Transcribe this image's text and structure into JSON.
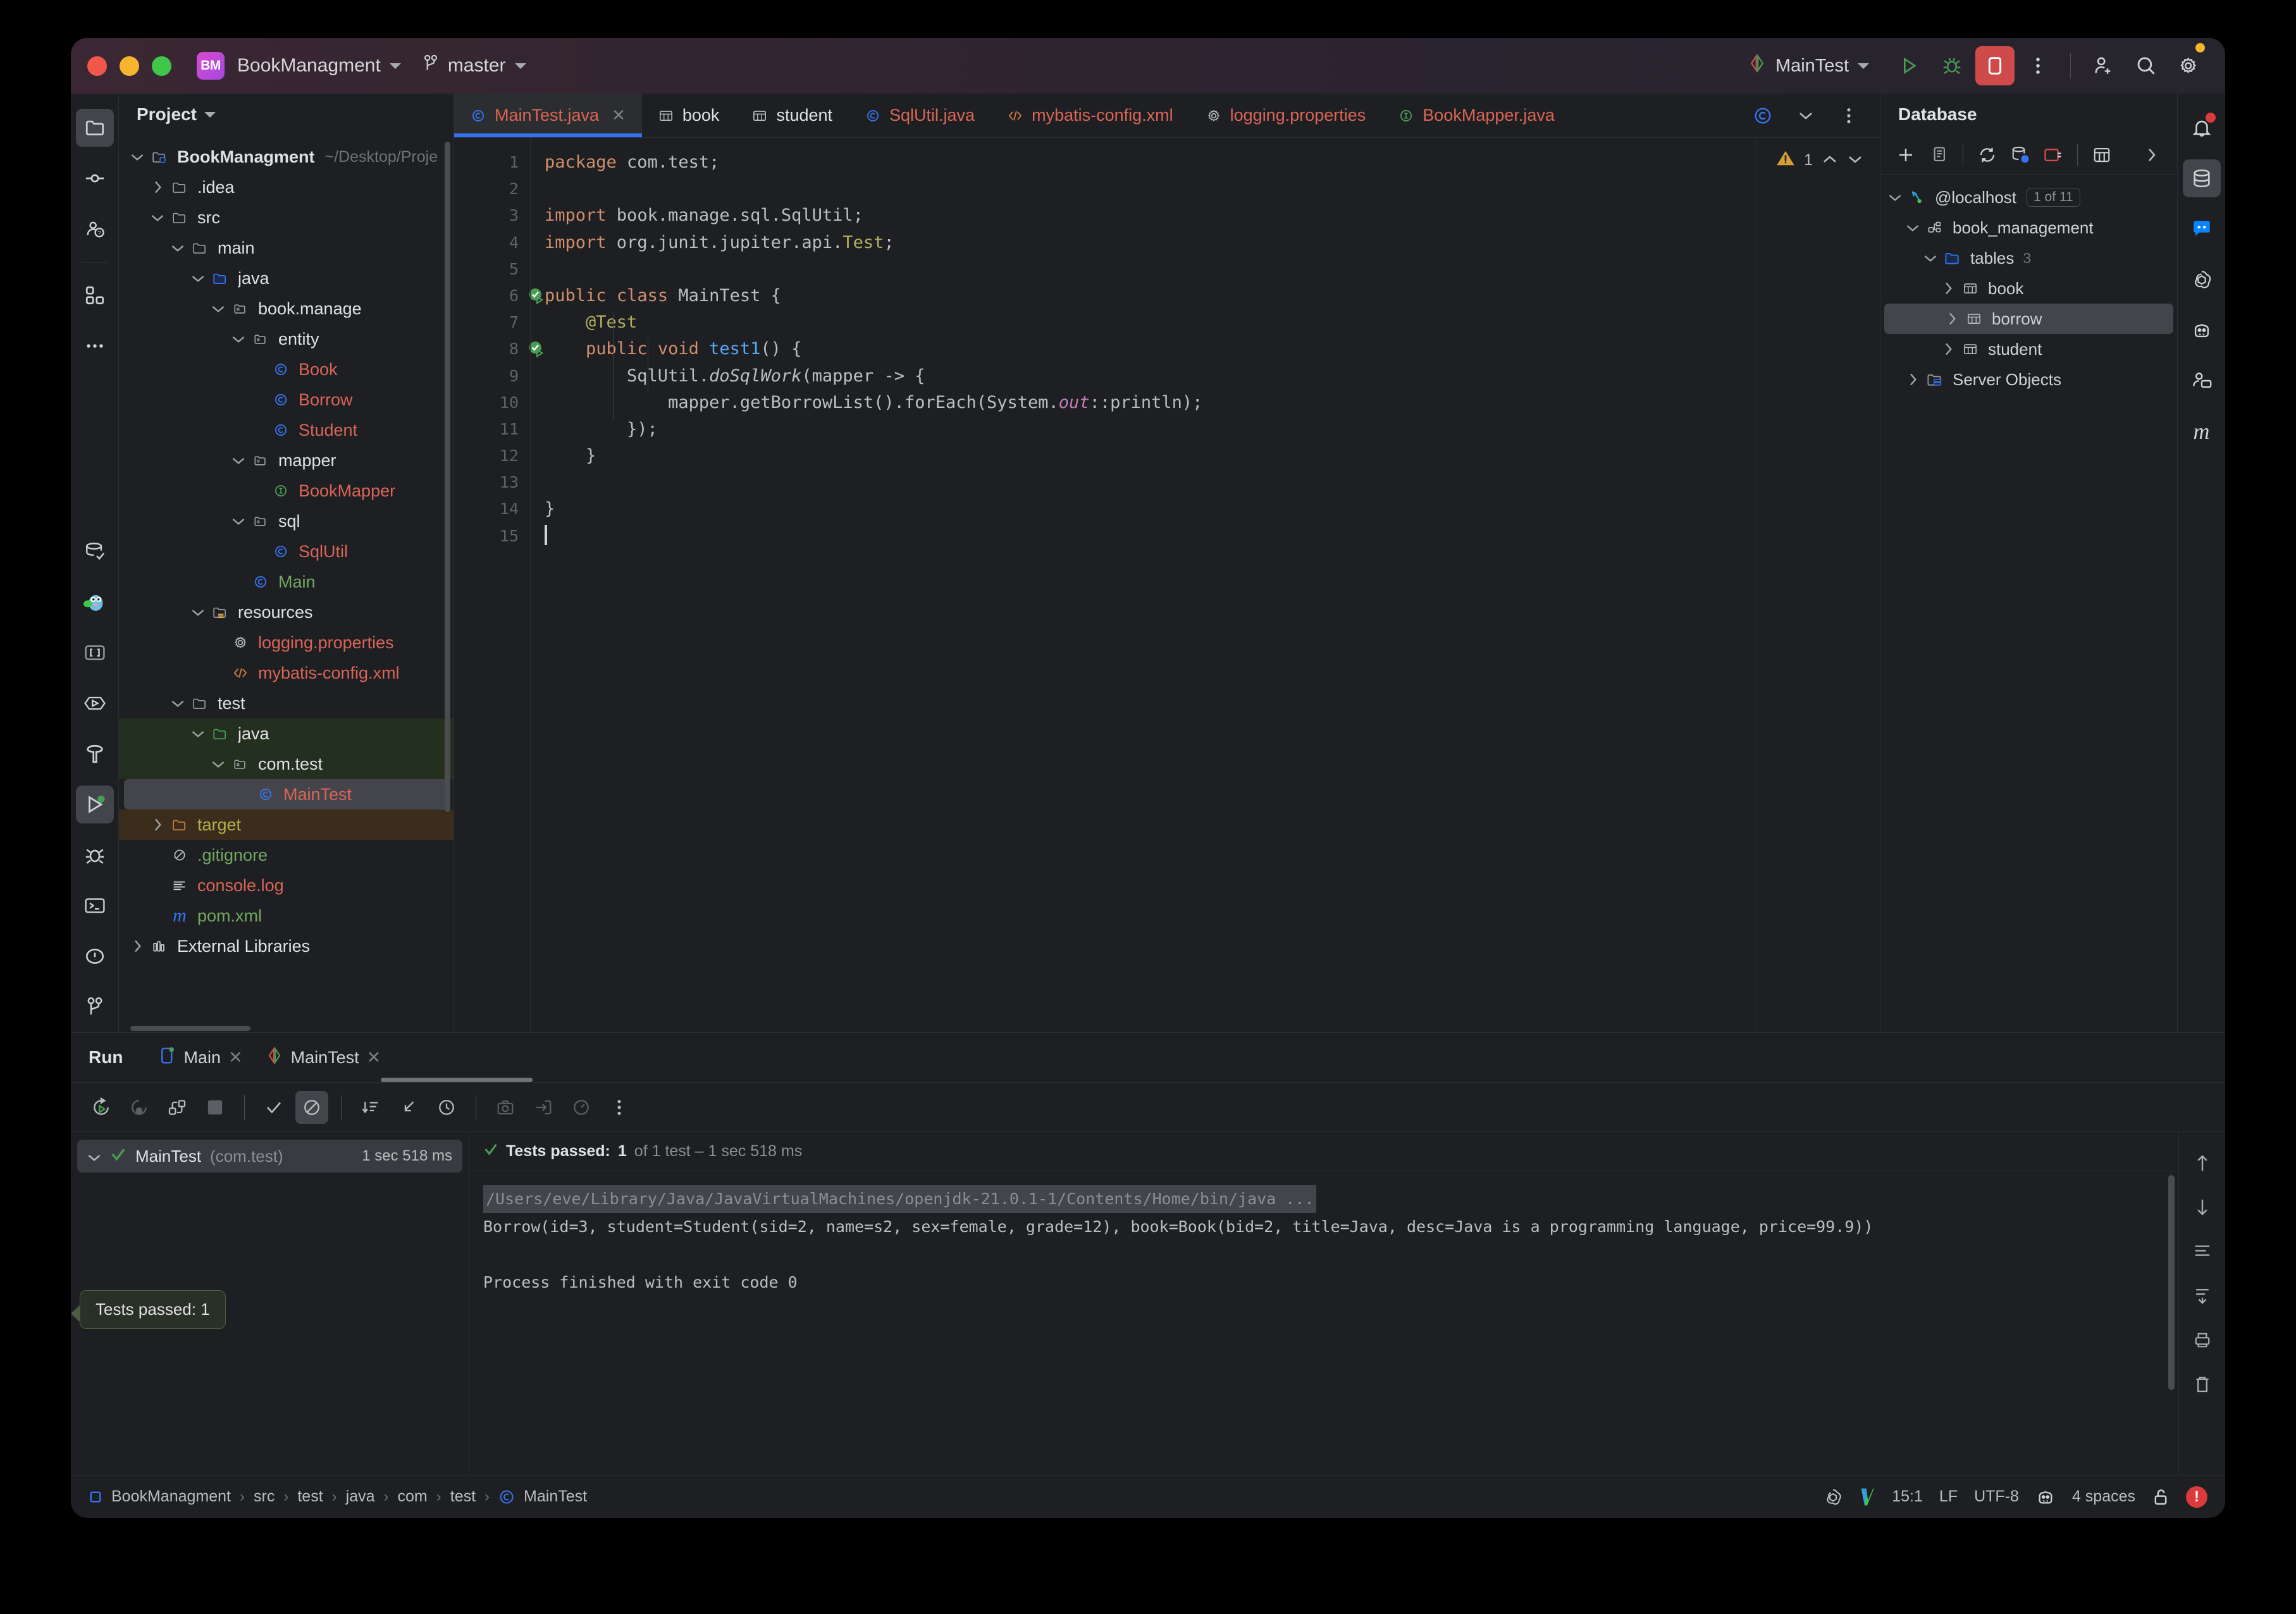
{
  "titlebar": {
    "project_badge": "BM",
    "project_name": "BookManagment",
    "branch": "master",
    "run_config": "MainTest"
  },
  "project_panel": {
    "header": "Project",
    "tree": [
      {
        "label": "BookManagment",
        "path": "~/Desktop/Proje",
        "icon": "module-folder-icon",
        "depth": 0,
        "twist": "down",
        "color": "white",
        "bold": true
      },
      {
        "label": ".idea",
        "icon": "folder-icon",
        "depth": 1,
        "twist": "right",
        "color": "white"
      },
      {
        "label": "src",
        "icon": "folder-icon",
        "depth": 1,
        "twist": "down",
        "color": "white"
      },
      {
        "label": "main",
        "icon": "folder-icon",
        "depth": 2,
        "twist": "down",
        "color": "white"
      },
      {
        "label": "java",
        "icon": "source-folder-icon",
        "depth": 3,
        "twist": "down",
        "color": "white"
      },
      {
        "label": "book.manage",
        "icon": "package-icon",
        "depth": 4,
        "twist": "down",
        "color": "white"
      },
      {
        "label": "entity",
        "icon": "package-icon",
        "depth": 5,
        "twist": "down",
        "color": "white"
      },
      {
        "label": "Book",
        "icon": "java-class-icon",
        "depth": 6,
        "twist": "none",
        "color": "red"
      },
      {
        "label": "Borrow",
        "icon": "java-class-icon",
        "depth": 6,
        "twist": "none",
        "color": "red"
      },
      {
        "label": "Student",
        "icon": "java-class-icon",
        "depth": 6,
        "twist": "none",
        "color": "red"
      },
      {
        "label": "mapper",
        "icon": "package-icon",
        "depth": 5,
        "twist": "down",
        "color": "white"
      },
      {
        "label": "BookMapper",
        "icon": "java-interface-icon",
        "depth": 6,
        "twist": "none",
        "color": "red"
      },
      {
        "label": "sql",
        "icon": "package-icon",
        "depth": 5,
        "twist": "down",
        "color": "white"
      },
      {
        "label": "SqlUtil",
        "icon": "java-class-icon",
        "depth": 6,
        "twist": "none",
        "color": "red"
      },
      {
        "label": "Main",
        "icon": "java-class-icon",
        "depth": 5,
        "twist": "none",
        "color": "green"
      },
      {
        "label": "resources",
        "icon": "resources-folder-icon",
        "depth": 3,
        "twist": "down",
        "color": "white"
      },
      {
        "label": "logging.properties",
        "icon": "gear-icon",
        "depth": 4,
        "twist": "none",
        "color": "red"
      },
      {
        "label": "mybatis-config.xml",
        "icon": "xml-icon",
        "depth": 4,
        "twist": "none",
        "color": "red"
      },
      {
        "label": "test",
        "icon": "folder-icon",
        "depth": 2,
        "twist": "down",
        "color": "white"
      },
      {
        "label": "java",
        "icon": "test-source-folder-icon",
        "depth": 3,
        "twist": "down",
        "color": "white",
        "bg": "green"
      },
      {
        "label": "com.test",
        "icon": "package-icon",
        "depth": 4,
        "twist": "down",
        "color": "white",
        "bg": "green"
      },
      {
        "label": "MainTest",
        "icon": "java-class-icon",
        "depth": 5,
        "twist": "none",
        "color": "red",
        "selected": true
      },
      {
        "label": "target",
        "icon": "excluded-folder-icon",
        "depth": 1,
        "twist": "right",
        "color": "yellow",
        "bg": "target"
      },
      {
        "label": ".gitignore",
        "icon": "gitignore-icon",
        "depth": 1,
        "twist": "none",
        "color": "green"
      },
      {
        "label": "console.log",
        "icon": "log-file-icon",
        "depth": 1,
        "twist": "none",
        "color": "red"
      },
      {
        "label": "pom.xml",
        "icon": "maven-icon",
        "depth": 1,
        "twist": "none",
        "color": "green"
      },
      {
        "label": "External Libraries",
        "icon": "libraries-icon",
        "depth": 0,
        "twist": "right",
        "color": "white"
      }
    ]
  },
  "editor": {
    "tabs": [
      {
        "label": "MainTest.java",
        "icon": "java-class-icon",
        "color": "red",
        "active": true,
        "closeable": true
      },
      {
        "label": "book",
        "icon": "table-icon",
        "color": "white",
        "active": false
      },
      {
        "label": "student",
        "icon": "table-icon",
        "color": "white",
        "active": false
      },
      {
        "label": "SqlUtil.java",
        "icon": "java-class-icon",
        "color": "red",
        "active": false
      },
      {
        "label": "mybatis-config.xml",
        "icon": "xml-icon",
        "color": "red",
        "active": false
      },
      {
        "label": "logging.properties",
        "icon": "gear-icon",
        "color": "red",
        "active": false
      },
      {
        "label": "BookMapper.java",
        "icon": "java-interface-icon",
        "color": "red",
        "active": false
      }
    ],
    "warning_count": "1",
    "line_numbers": [
      "1",
      "2",
      "3",
      "4",
      "5",
      "6",
      "7",
      "8",
      "9",
      "10",
      "11",
      "12",
      "13",
      "14",
      "15"
    ],
    "code_lines": [
      "package com.test;",
      "",
      "import book.manage.sql.SqlUtil;",
      "import org.junit.jupiter.api.Test;",
      "",
      "public class MainTest {",
      "    @Test",
      "    public void test1() {",
      "        SqlUtil.doSqlWork(mapper -> {",
      "            mapper.getBorrowList().forEach(System.out::println);",
      "        });",
      "    }",
      "",
      "}",
      ""
    ]
  },
  "database": {
    "header": "Database",
    "toolbar_icons": [
      "add-icon",
      "duplicate-icon",
      "refresh-icon",
      "db-settings-icon",
      "disconnect-icon",
      "table-view-icon",
      "expand-icon"
    ],
    "tree": [
      {
        "label": "@localhost",
        "badge": "1 of 11",
        "icon": "datasource-icon",
        "depth": 0,
        "twist": "down"
      },
      {
        "label": "book_management",
        "icon": "schema-icon",
        "depth": 1,
        "twist": "down"
      },
      {
        "label": "tables",
        "count": "3",
        "icon": "tables-folder-icon",
        "depth": 2,
        "twist": "down"
      },
      {
        "label": "book",
        "icon": "table-icon",
        "depth": 3,
        "twist": "right"
      },
      {
        "label": "borrow",
        "icon": "table-icon",
        "depth": 3,
        "twist": "right",
        "selected": true
      },
      {
        "label": "student",
        "icon": "table-icon",
        "depth": 3,
        "twist": "right"
      },
      {
        "label": "Server Objects",
        "icon": "server-objects-icon",
        "depth": 1,
        "twist": "right"
      }
    ]
  },
  "run_panel": {
    "title": "Run",
    "tabs": [
      {
        "label": "Main",
        "icon": "run-config-app-icon",
        "active": false
      },
      {
        "label": "MainTest",
        "icon": "junit-icon",
        "active": true
      }
    ],
    "toolbar_icons": [
      "rerun-icon",
      "rerun-failed-icon",
      "toggle-auto-test-icon",
      "stop-icon",
      "show-passed-icon",
      "hide-ignored-icon",
      "sort-by-duration-icon",
      "expand-all-icon",
      "history-icon",
      "export-icon",
      "import-icon",
      "settings-gauge-icon",
      "more-icon"
    ],
    "test_tree": {
      "name": "MainTest",
      "package": "(com.test)",
      "duration": "1 sec 518 ms"
    },
    "tooltip": "Tests passed: 1",
    "status": {
      "passed_label": "Tests passed:",
      "passed_count": "1",
      "detail": "of 1 test – 1 sec 518 ms"
    },
    "console": [
      "/Users/eve/Library/Java/JavaVirtualMachines/openjdk-21.0.1-1/Contents/Home/bin/java ...",
      "Borrow(id=3, student=Student(sid=2, name=s2, sex=female, grade=12), book=Book(bid=2, title=Java, desc=Java is a programming language, price=99.9))",
      "",
      "Process finished with exit code 0"
    ],
    "console_rail_icons": [
      "scroll-up-icon",
      "scroll-down-icon",
      "soft-wrap-icon",
      "scroll-end-icon",
      "print-icon",
      "trash-icon"
    ]
  },
  "statusbar": {
    "breadcrumb": [
      "BookManagment",
      "src",
      "test",
      "java",
      "com",
      "test",
      "MainTest"
    ],
    "caret_position": "15:1",
    "line_separator": "LF",
    "encoding": "UTF-8",
    "indent": "4 spaces",
    "right_icons": [
      "openai-icon",
      "vim-icon",
      "ai-assistant-icon",
      "lock-icon",
      "error-icon"
    ]
  },
  "left_rail_icons": [
    "project-icon",
    "commit-icon",
    "pull-requests-icon",
    "plugins-icon",
    "more-icon",
    "database-check-icon",
    "gopher-icon",
    "brackets-icon",
    "preview-icon",
    "build-icon",
    "run-icon",
    "debug-icon",
    "terminal-icon",
    "problems-icon",
    "version-control-icon"
  ],
  "right_rail_icons": [
    "notifications-icon",
    "database-icon",
    "chat-icon",
    "openai-icon",
    "ai-assistant-icon",
    "collaborate-icon",
    "maven-icon"
  ],
  "colors": {
    "accent": "#3574f0",
    "red_file": "#d96557",
    "green_file": "#71a860",
    "stop_red": "#cf4b4b",
    "warning_yellow": "#d4a139",
    "selection": "#43454a"
  }
}
